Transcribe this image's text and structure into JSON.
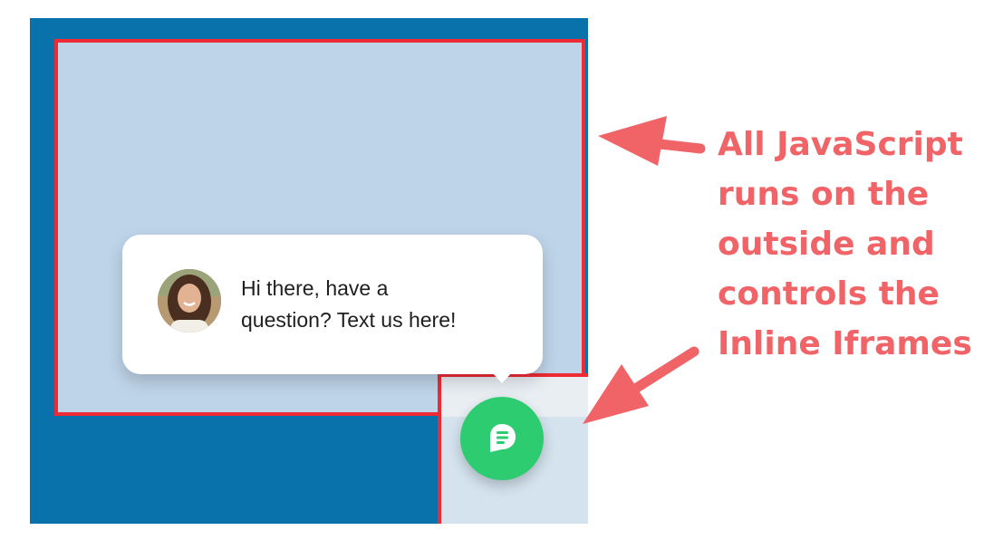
{
  "chat_popup": {
    "message_line_1": "Hi there, have a",
    "message_line_2": "question? Text us here!"
  },
  "launcher": {
    "icon": "chat-message-icon",
    "color": "#2ecc71"
  },
  "annotation": {
    "lines": [
      "All JavaScript",
      "runs on the",
      "outside and",
      "controls the",
      "Inline Iframes"
    ],
    "color": "#f06468"
  },
  "colors": {
    "page_background": "#0a72aa",
    "iframe_background": "#bed4e8",
    "iframe_border": "#ee2a35"
  }
}
